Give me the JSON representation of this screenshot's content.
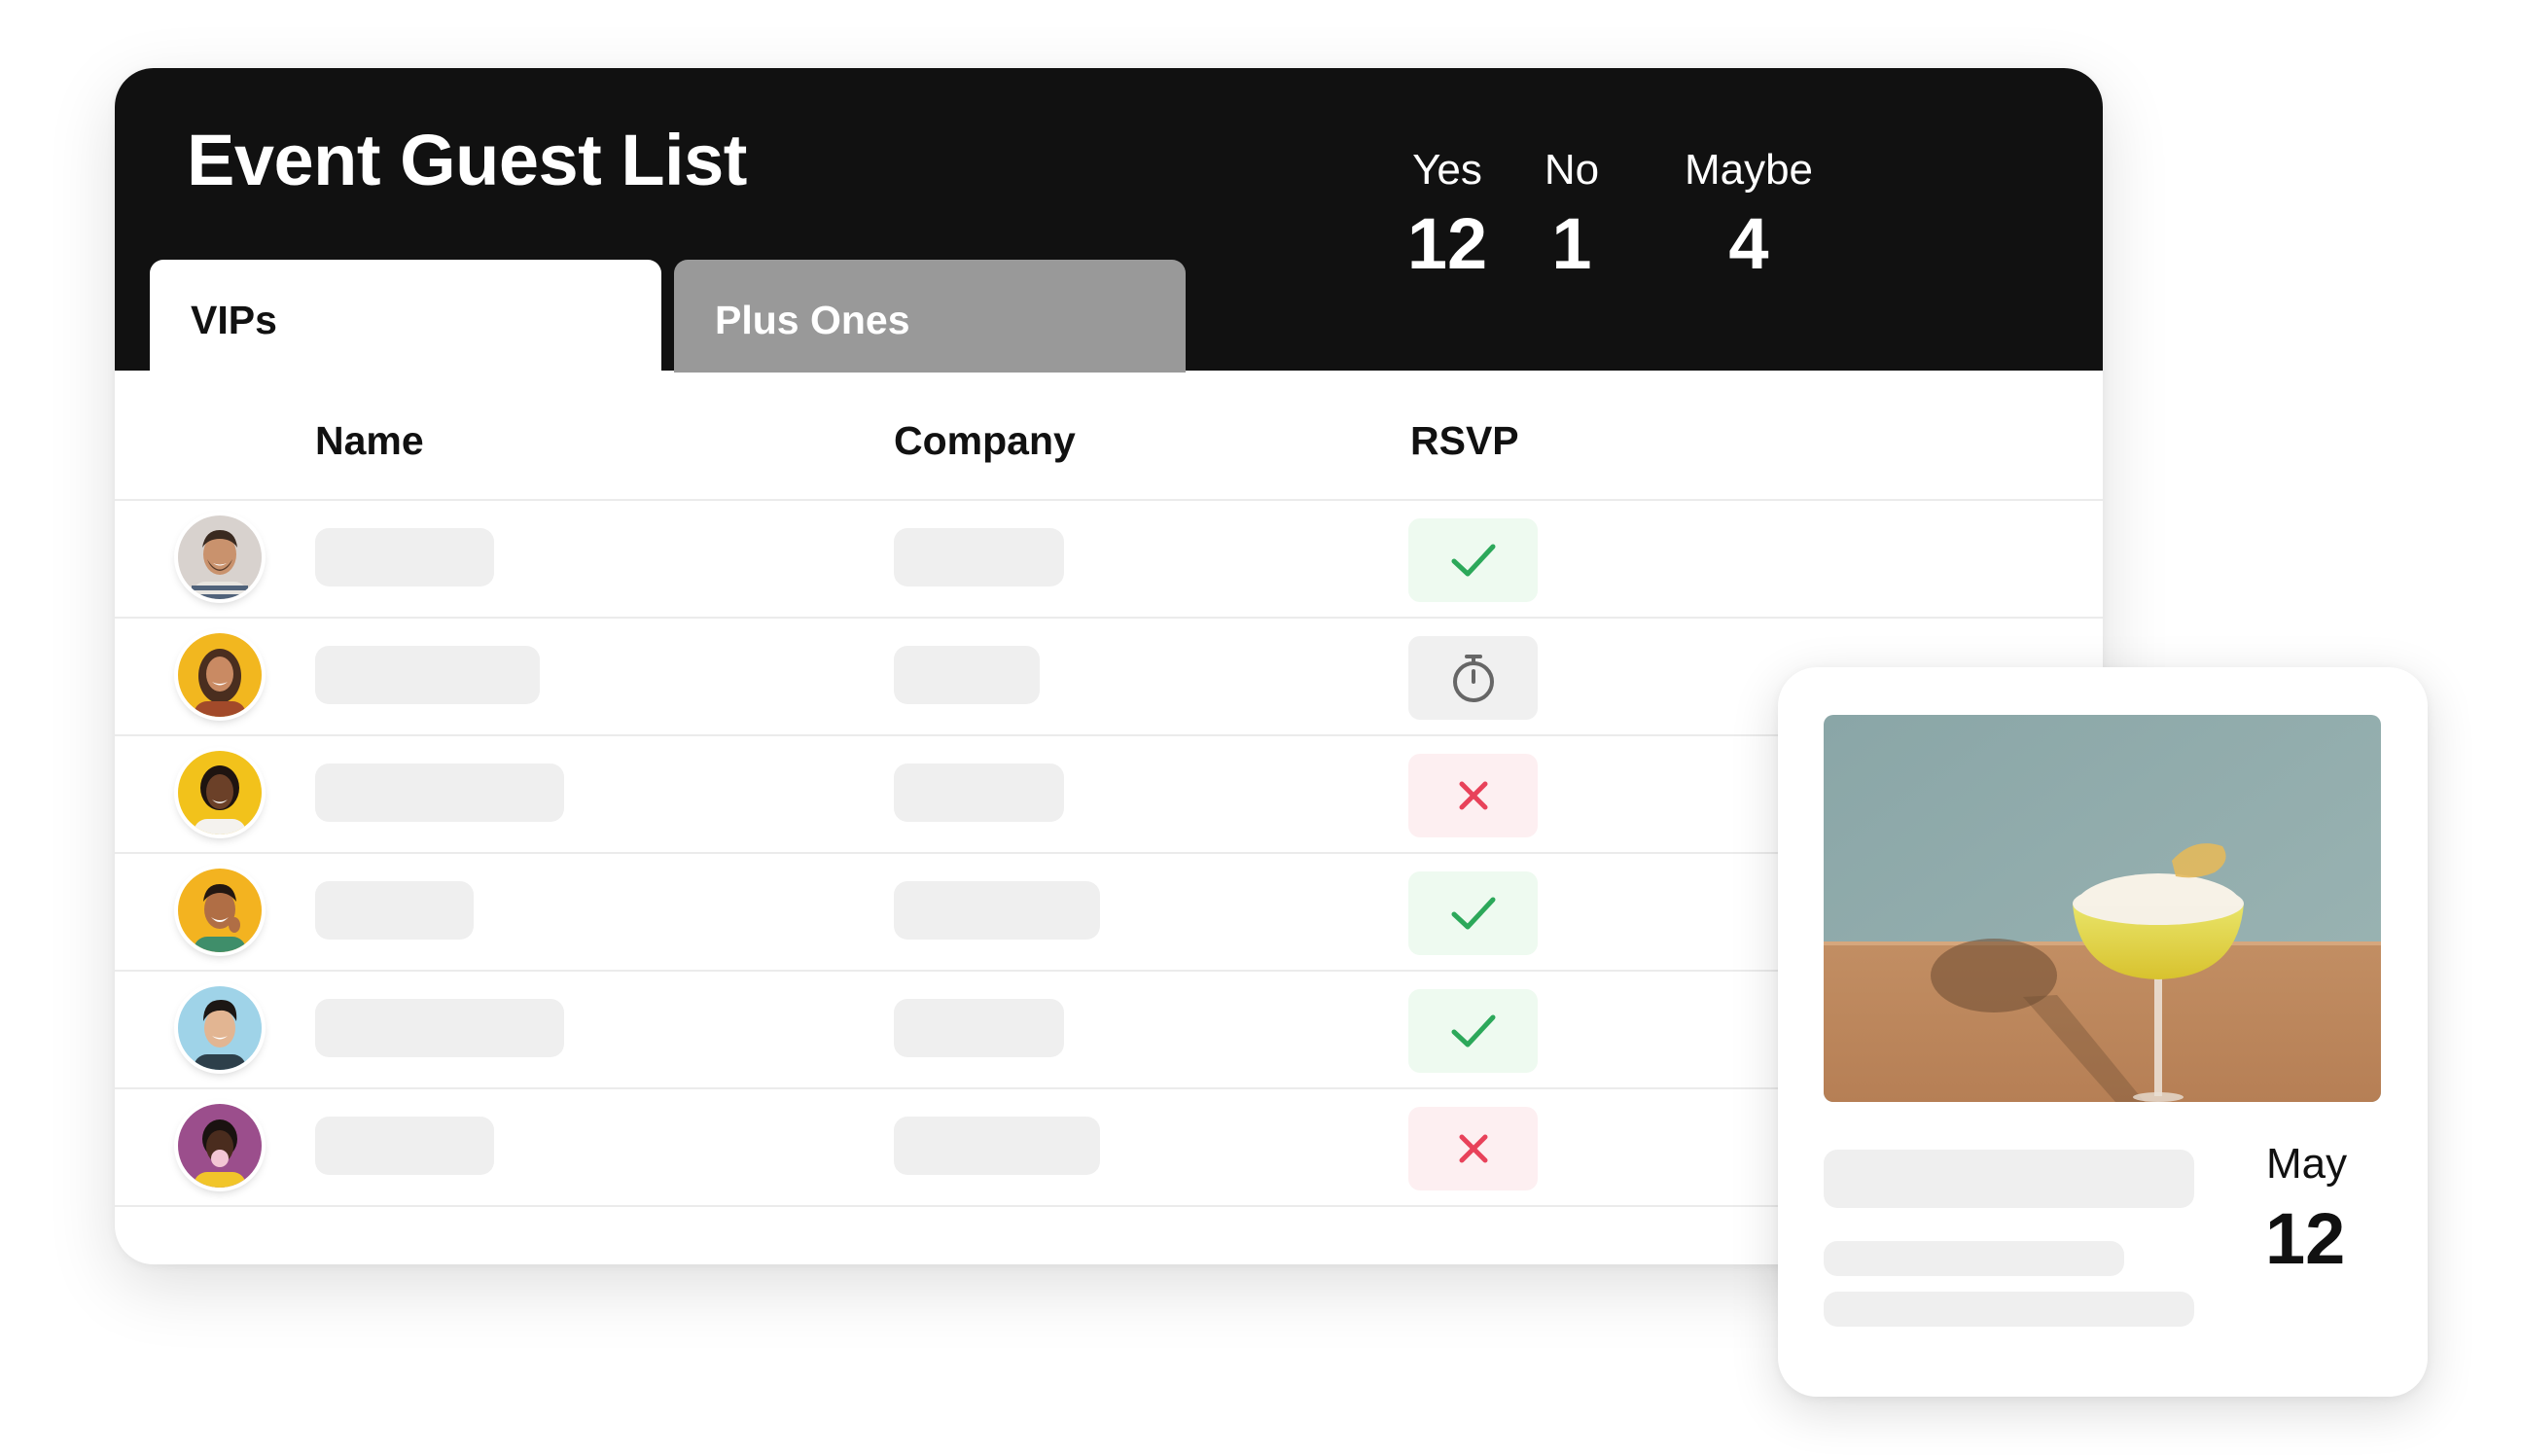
{
  "header": {
    "title": "Event Guest List"
  },
  "tabs": [
    {
      "label": "VIPs",
      "active": true
    },
    {
      "label": "Plus Ones",
      "active": false
    }
  ],
  "stats": [
    {
      "label": "Yes",
      "value": "12"
    },
    {
      "label": "No",
      "value": "1"
    },
    {
      "label": "Maybe",
      "value": "4"
    }
  ],
  "table": {
    "columns": [
      "Name",
      "Company",
      "RSVP"
    ],
    "rows": [
      {
        "rsvp": "yes",
        "rsvp_icon": "check-icon"
      },
      {
        "rsvp": "maybe",
        "rsvp_icon": "stopwatch-icon"
      },
      {
        "rsvp": "no",
        "rsvp_icon": "x-icon"
      },
      {
        "rsvp": "yes",
        "rsvp_icon": "check-icon"
      },
      {
        "rsvp": "yes",
        "rsvp_icon": "check-icon"
      },
      {
        "rsvp": "no",
        "rsvp_icon": "x-icon"
      }
    ]
  },
  "event": {
    "month": "May",
    "day": "12"
  },
  "colors": {
    "header_bg": "#111111",
    "inactive_tab": "#999999",
    "yes_bg": "#eefaf0",
    "yes_fg": "#2ca85a",
    "no_bg": "#fdeff1",
    "no_fg": "#e8425a",
    "maybe_bg": "#f0f0f0",
    "maybe_fg": "#666666",
    "placeholder": "#efefef"
  }
}
